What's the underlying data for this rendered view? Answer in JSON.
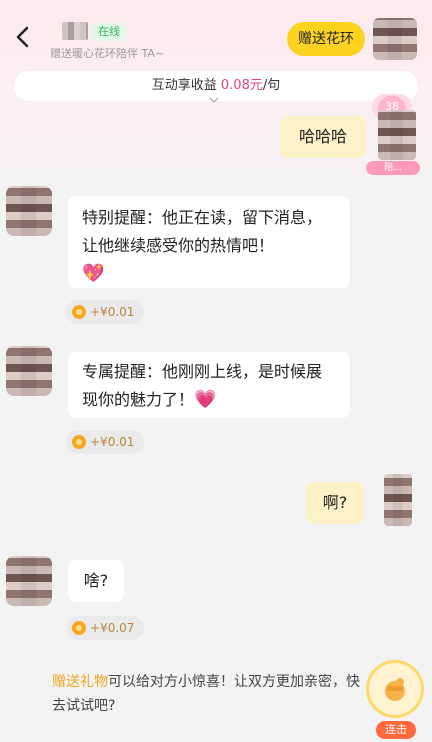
{
  "header": {
    "back_icon": "chevron-left-icon",
    "status_badge": "在线",
    "subtitle": "赠送暖心花环陪伴 TA~",
    "gift_button": "赠送花环"
  },
  "earnings": {
    "prefix": "互动享收益 ",
    "amount": "0.08元",
    "suffix": "/句"
  },
  "level": {
    "badge": "38",
    "tag": "陪..."
  },
  "messages": [
    {
      "side": "right",
      "text": "哈哈哈"
    },
    {
      "side": "left",
      "text": "特别提醒：他正在读，留下消息，让他继续感受你的热情吧！",
      "emoji": "💖",
      "reward": "+¥0.01"
    },
    {
      "side": "left",
      "text": "专属提醒：他刚刚上线，是时候展现你的魅力了！",
      "emoji": "💗",
      "reward": "+¥0.01"
    },
    {
      "side": "right",
      "text": "啊?"
    },
    {
      "side": "left",
      "text": "啥?",
      "reward": "+¥0.07"
    }
  ],
  "footer": {
    "highlight": "赠送礼物",
    "text": "可以给对方小惊喜！让双方更加亲密，快去试试吧?",
    "combo_label": "连击",
    "combo_icon": "gift-hand-icon"
  },
  "colors": {
    "accent_yellow": "#ffd21f",
    "amount_pink": "#e0467e",
    "online_green": "#2fb65a",
    "self_bubble": "#fdf1c7"
  }
}
